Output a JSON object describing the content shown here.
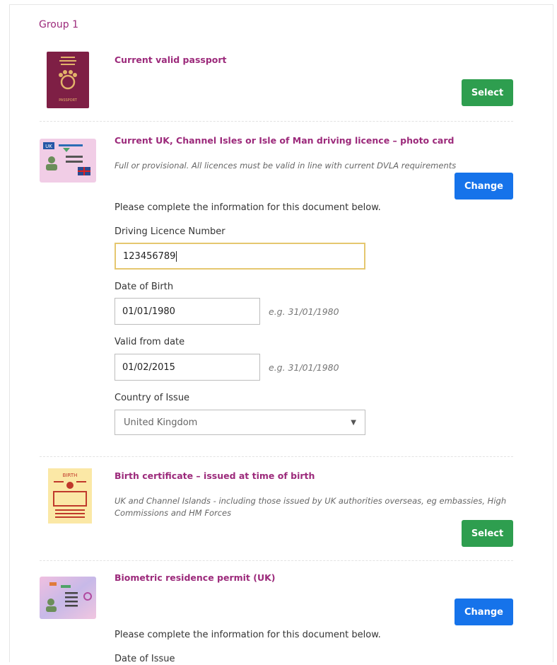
{
  "group": {
    "title": "Group 1"
  },
  "documents": [
    {
      "title": "Current valid passport",
      "icon": "passport-icon",
      "button": "Select",
      "icon_text": "PASSPORT"
    },
    {
      "title": "Current UK, Channel Isles or Isle of Man driving licence – photo card",
      "note": "Full or provisional. All licences must be valid in line with current DVLA requirements",
      "icon": "driving-licence-icon",
      "icon_text": "UK",
      "button": "Change",
      "instruction": "Please complete the information for this document below.",
      "fields": {
        "licence_number": {
          "label": "Driving Licence Number",
          "value": "123456789"
        },
        "dob": {
          "label": "Date of Birth",
          "value": "01/01/1980",
          "hint": "e.g. 31/01/1980"
        },
        "valid_from": {
          "label": "Valid from date",
          "value": "01/02/2015",
          "hint": "e.g. 31/01/1980"
        },
        "country": {
          "label": "Country of Issue",
          "value": "United Kingdom"
        }
      }
    },
    {
      "title": "Birth certificate – issued at time of birth",
      "note_line1": "UK and Channel Islands - including those issued by UK authorities overseas, eg embassies, High",
      "note_line2": "Commissions and HM Forces",
      "icon": "birth-certificate-icon",
      "icon_text": "BIRTH",
      "button": "Select"
    },
    {
      "title": "Biometric residence permit (UK)",
      "icon": "residence-permit-icon",
      "button": "Change",
      "instruction": "Please complete the information for this document below.",
      "next_label": "Date of Issue"
    }
  ],
  "colors": {
    "accent": "#9c2a7b",
    "select_green": "#2e9e4f",
    "change_blue": "#1673ea",
    "focus_border": "#e5c76f"
  }
}
